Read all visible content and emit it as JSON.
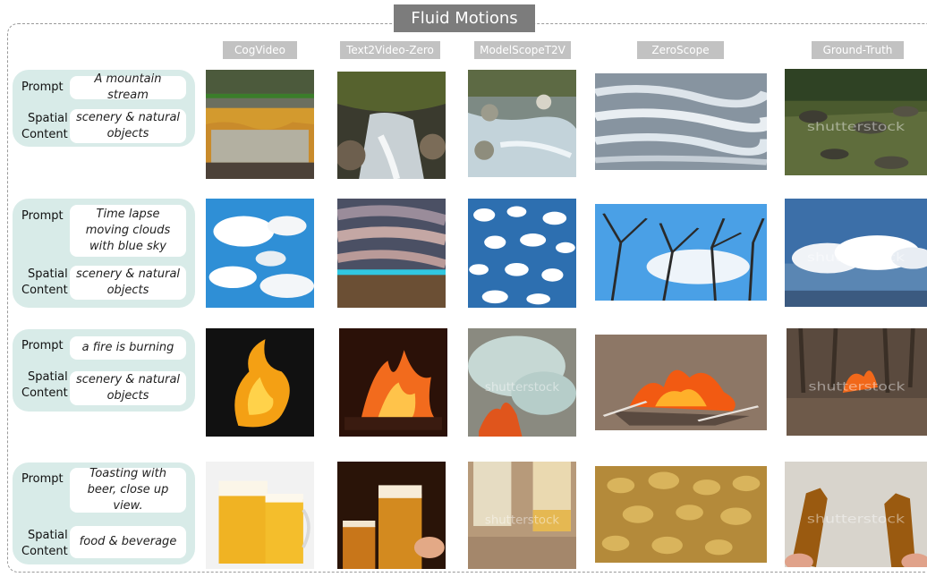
{
  "figure_title": "Fluid Motions",
  "columns": [
    "CogVideo",
    "Text2Video-Zero",
    "ModelScopeT2V",
    "ZeroScope",
    "Ground-Truth"
  ],
  "rows": [
    {
      "prompt_label": "Prompt",
      "prompt": "A mountain stream",
      "spatial_label_1": "Spatial",
      "spatial_label_2": "Content",
      "spatial": "scenery & natural objects",
      "scene": "stream"
    },
    {
      "prompt_label": "Prompt",
      "prompt": "Time lapse moving clouds with blue sky",
      "spatial_label_1": "Spatial",
      "spatial_label_2": "Content",
      "spatial": "scenery & natural objects",
      "scene": "clouds"
    },
    {
      "prompt_label": "Prompt",
      "prompt": "a fire is burning",
      "spatial_label_1": "Spatial",
      "spatial_label_2": "Content",
      "spatial": "scenery & natural objects",
      "scene": "fire"
    },
    {
      "prompt_label": "Prompt",
      "prompt": "Toasting with beer, close up view.",
      "spatial_label_1": "Spatial",
      "spatial_label_2": "Content",
      "spatial": "food & beverage",
      "scene": "beer"
    }
  ],
  "watermark": "shutterstock"
}
